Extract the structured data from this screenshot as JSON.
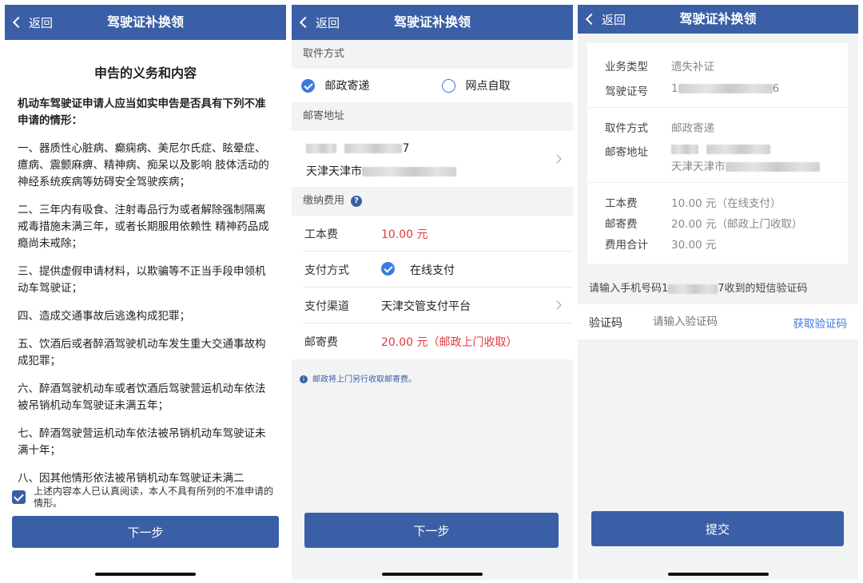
{
  "colors": {
    "brand": "#3a5fa6",
    "accent_blue": "#3a7be0",
    "price_red": "#e0393e"
  },
  "screen1": {
    "back_label": "返回",
    "title": "驾驶证补换领",
    "doc_title": "申告的义务和内容",
    "lead": "机动车驾驶证申请人应当如实申告是否具有下列不准申请的情形：",
    "items": [
      "一、器质性心脏病、癫痫病、美尼尔氏症、眩晕症、癔病、震颤麻痹、精神病、痴呆以及影响 肢体活动的神经系统疾病等妨碍安全驾驶疾病；",
      "二、三年内有吸食、注射毒品行为或者解除强制隔离戒毒措施未满三年，或者长期服用依赖性 精神药品成瘾尚未戒除；",
      "三、提供虚假申请材料，以欺骗等不正当手段申领机动车驾驶证；",
      "四、造成交通事故后逃逸构成犯罪；",
      "五、饮酒后或者醉酒驾驶机动车发生重大交通事故构成犯罪；",
      "六、醉酒驾驶机动车或者饮酒后驾驶营运机动车依法被吊销机动车驾驶证未满五年；",
      "七、醉酒驾驶营运机动车依法被吊销机动车驾驶证未满十年；",
      "八、因其他情形依法被吊销机动车驾驶证未满二"
    ],
    "agree_text": "上述内容本人已认真阅读，本人不具有所列的不准申请的情形。",
    "agree_checked": true,
    "next_label": "下一步"
  },
  "screen2": {
    "back_label": "返回",
    "title": "驾驶证补换领",
    "pickup_header": "取件方式",
    "pickup_options": [
      {
        "label": "邮政寄递",
        "selected": true
      },
      {
        "label": "网点自取",
        "selected": false
      }
    ],
    "address_header": "邮寄地址",
    "address_line1_suffix": "7",
    "address_line2_prefix": "天津天津市",
    "fee_header": "缴纳费用",
    "fee_help_icon": "?",
    "rows": {
      "cost_label": "工本费",
      "cost_value": "10.00 元",
      "pay_method_label": "支付方式",
      "pay_method_value": "在线支付",
      "pay_channel_label": "支付渠道",
      "pay_channel_value": "天津交管支付平台",
      "postage_label": "邮寄费",
      "postage_value": "20.00 元（邮政上门收取）"
    },
    "info_icon": "i",
    "note": "邮政将上门另行收取邮寄费。",
    "next_label": "下一步"
  },
  "screen3": {
    "back_label": "返回",
    "title": "驾驶证补换领",
    "business_type_label": "业务类型",
    "business_type_value": "遗失补证",
    "license_no_label": "驾驶证号",
    "license_no_start": "1",
    "license_no_end": "6",
    "pickup_label": "取件方式",
    "pickup_value": "邮政寄递",
    "address_label": "邮寄地址",
    "address_line2_prefix": "天津天津市",
    "cost_label": "工本费",
    "cost_value": "10.00 元（在线支付）",
    "postage_label": "邮寄费",
    "postage_value": "20.00 元（邮政上门收取）",
    "total_label": "费用合计",
    "total_value": "30.00 元",
    "sms_hint_prefix": "请输入手机号码1",
    "sms_hint_suffix": "7收到的短信验证码",
    "code_label": "验证码",
    "code_placeholder": "请输入验证码",
    "get_code_label": "获取验证码",
    "submit_label": "提交"
  }
}
